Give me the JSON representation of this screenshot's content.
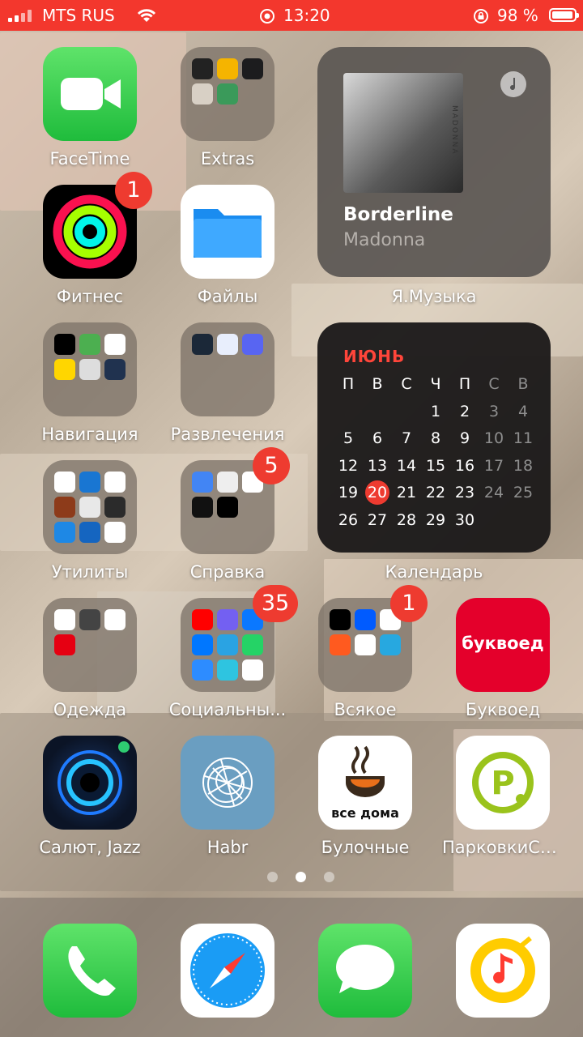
{
  "status": {
    "carrier": "MTS RUS",
    "time": "13:20",
    "battery": "98 %"
  },
  "apps": {
    "facetime": "FaceTime",
    "extras": "Extras",
    "fitness": "Фитнес",
    "files": "Файлы",
    "navigation": "Навигация",
    "entertainment": "Развлечения",
    "utilities": "Утилиты",
    "reference": "Справка",
    "clothing": "Одежда",
    "social": "Социальны...",
    "misc": "Всякое",
    "bukvoed": "Буквоед",
    "salut": "Салют, Jazz",
    "habr": "Habr",
    "bakeries": "Булочные",
    "parking": "ПарковкиСа..."
  },
  "badges": {
    "fitness": "1",
    "reference": "5",
    "social": "35",
    "misc": "1"
  },
  "music_widget": {
    "track": "Borderline",
    "artist": "Madonna",
    "label": "Я.Музыка",
    "cover_text": "MADONNA"
  },
  "calendar_widget": {
    "month": "ИЮНЬ",
    "label": "Календарь",
    "weekdays": [
      "П",
      "В",
      "С",
      "Ч",
      "П",
      "С",
      "В"
    ],
    "weeks": [
      [
        "",
        "",
        "",
        "1",
        "2",
        "3",
        "4"
      ],
      [
        "5",
        "6",
        "7",
        "8",
        "9",
        "10",
        "11"
      ],
      [
        "12",
        "13",
        "14",
        "15",
        "16",
        "17",
        "18"
      ],
      [
        "19",
        "20",
        "21",
        "22",
        "23",
        "24",
        "25"
      ],
      [
        "26",
        "27",
        "28",
        "29",
        "30",
        "",
        ""
      ]
    ],
    "today": "20"
  },
  "bukvoed_logo": "буквоед",
  "bakery_logo": "все дома",
  "colors": {
    "status_bar": "#f3372d",
    "badge": "#ee3b30",
    "calendar_month": "#ff453a"
  }
}
